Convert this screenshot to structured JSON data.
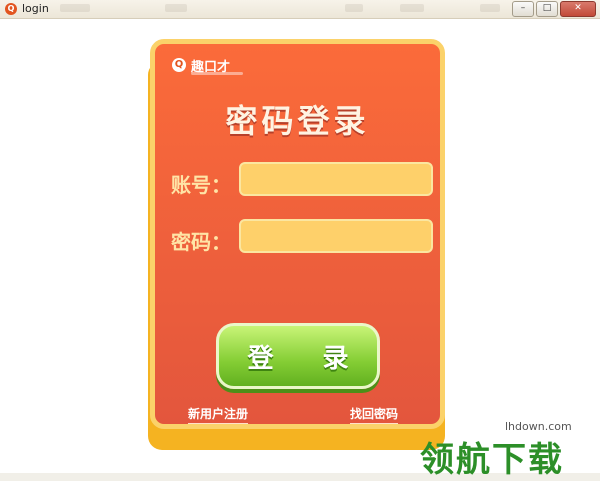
{
  "window": {
    "title": "login",
    "controls": {
      "minimize": "–",
      "restore": "□",
      "close": "✕"
    }
  },
  "logo": {
    "glyph": "Q",
    "name": "趣口才"
  },
  "heading": "密码登录",
  "form": {
    "account_label": "账号：",
    "account_value": "",
    "password_label": "密码：",
    "password_value": ""
  },
  "login_button": "登 录",
  "links": {
    "register": "新用户注册",
    "forgot": "找回密码"
  },
  "watermark": {
    "url": "lhdown.com",
    "text": "领航下载"
  },
  "colors": {
    "card": "#f1583c",
    "card_border": "#fbd26a",
    "field": "#fed06a",
    "button": "#8fd43c"
  }
}
